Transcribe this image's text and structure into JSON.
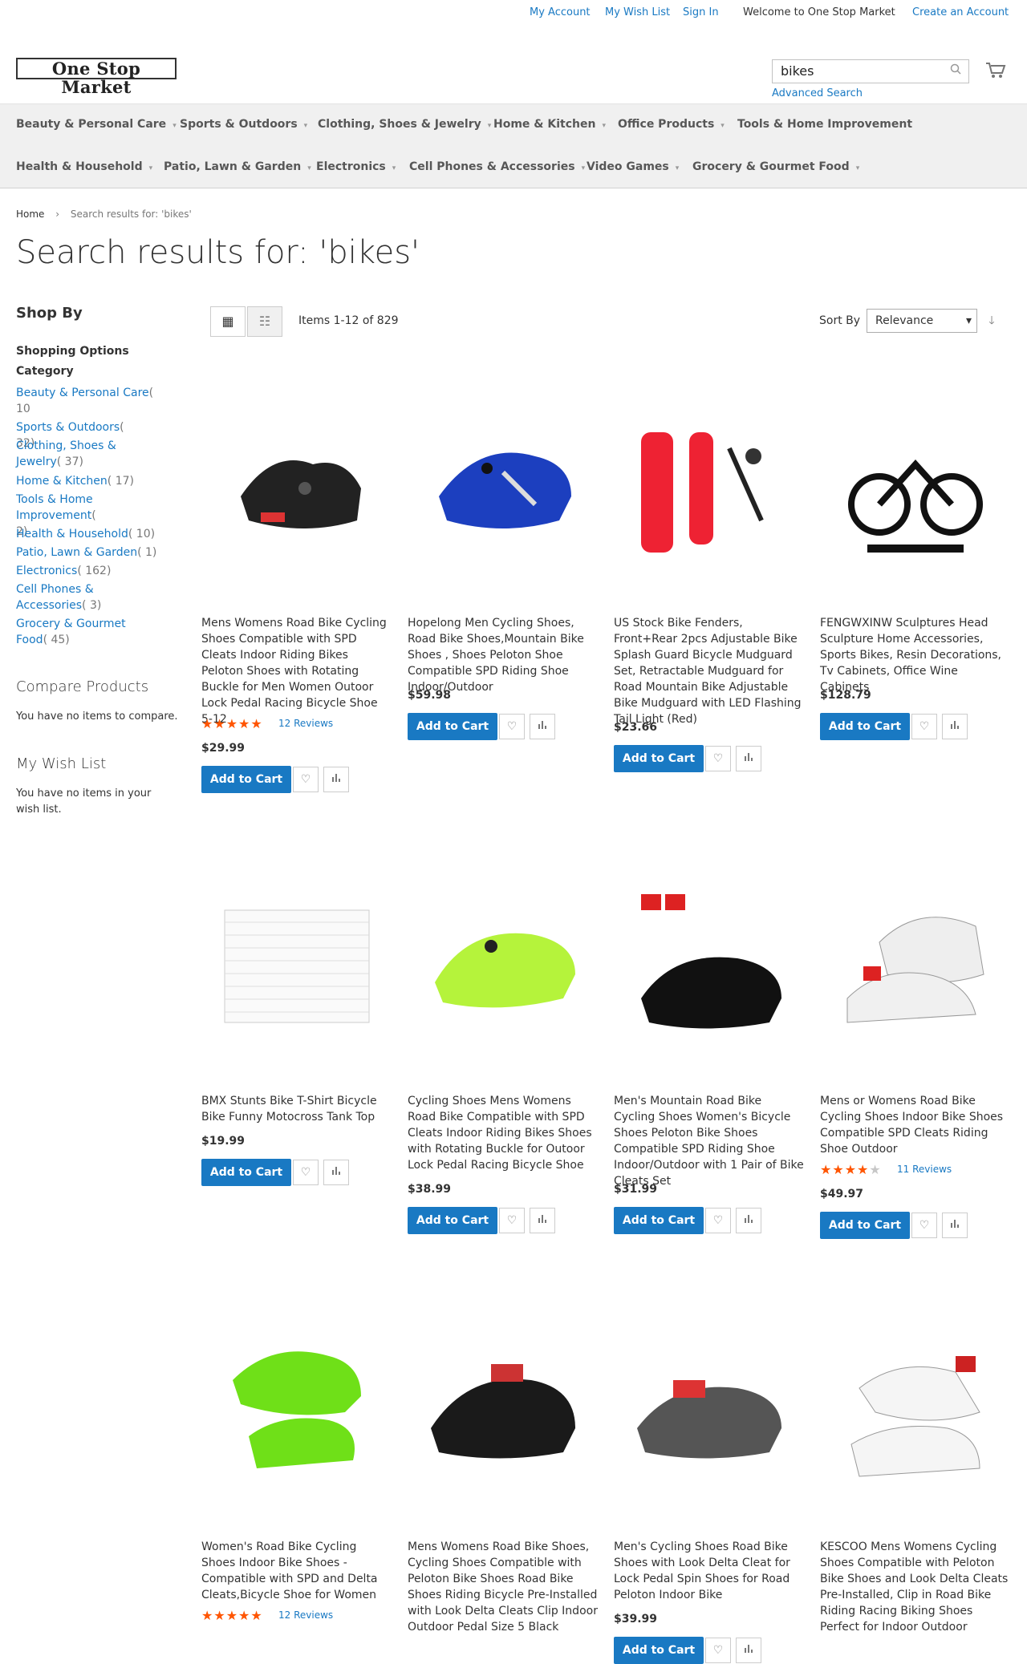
{
  "header": {
    "my_account": "My Account",
    "my_wish_list": "My Wish List",
    "sign_in": "Sign In",
    "welcome": "Welcome to One Stop Market",
    "create_account": "Create an Account",
    "logo": "One Stop Market",
    "search_value": "bikes",
    "advanced_search": "Advanced Search"
  },
  "nav": [
    "Beauty & Personal Care",
    "Sports & Outdoors",
    "Clothing, Shoes & Jewelry",
    "Home & Kitchen",
    "Office Products",
    "Tools & Home Improvement",
    "Health & Household",
    "Patio, Lawn & Garden",
    "Electronics",
    "Cell Phones & Accessories",
    "Video Games",
    "Grocery & Gourmet Food"
  ],
  "breadcrumb": {
    "home": "Home",
    "current": "Search results for: 'bikes'"
  },
  "page_title": "Search results for: 'bikes'",
  "sidebar": {
    "shop_by": "Shop By",
    "shopping_options": "Shopping Options",
    "category": "Category",
    "categories": [
      {
        "label": "Beauty & Personal Care",
        "count": "( 10"
      },
      {
        "label": "Sports & Outdoors",
        "count": "( 32)"
      },
      {
        "label": "Clothing, Shoes & Jewelry",
        "count": "( 37)"
      },
      {
        "label": "Home & Kitchen",
        "count": "( 17)"
      },
      {
        "label": "Tools & Home Improvement",
        "count": "( 2)"
      },
      {
        "label": "Health & Household",
        "count": "( 10)"
      },
      {
        "label": "Patio, Lawn & Garden",
        "count": "( 1)"
      },
      {
        "label": "Electronics",
        "count": "( 162)"
      },
      {
        "label": "Cell Phones & Accessories",
        "count": "( 3)"
      },
      {
        "label": "Grocery & Gourmet Food",
        "count": "( 45)"
      }
    ],
    "compare_title": "Compare Products",
    "compare_text": "You have no items to compare.",
    "wishlist_title": "My Wish List",
    "wishlist_text": "You have no items in your wish list."
  },
  "toolbar": {
    "amount": "Items 1-12 of 829",
    "sort_by": "Sort By",
    "sort_value": "Relevance"
  },
  "product_labels": {
    "add_to_cart": "Add to Cart"
  },
  "products": [
    {
      "name": "Mens Womens Road Bike Cycling Shoes Compatible with SPD Cleats Indoor Riding Bikes Peloton Shoes with Rotating Buckle for Men Women Outoor Lock Pedal Racing Bicycle Shoe 5-12",
      "price": "$29.99",
      "rating": 4.5,
      "reviews": "12  Reviews",
      "image": "black-cycling-shoe"
    },
    {
      "name": "Hopelong Men Cycling Shoes, Road Bike Shoes,Mountain Bike Shoes , Shoes Peloton Shoe Compatible SPD Riding Shoe Indoor/Outdoor",
      "price": "$59.98",
      "image": "blue-cycling-shoe"
    },
    {
      "name": "US Stock Bike Fenders, Front+Rear 2pcs Adjustable Bike Splash Guard Bicycle Mudguard Set, Retractable Mudguard for Road Mountain Bike Adjustable Bike Mudguard with LED Flashing Tail Light (Red)",
      "price": "$23.66",
      "image": "red-fenders"
    },
    {
      "name": "FENGWXINW Sculptures Head Sculpture Home Accessories, Sports Bikes, Resin Decorations, Tv Cabinets, Office Wine Cabinets",
      "price": "$128.79",
      "image": "bike-sculpture"
    },
    {
      "name": "BMX Stunts Bike T-Shirt Bicycle Bike Funny Motocross Tank Top",
      "price": "$19.99",
      "image": "size-chart"
    },
    {
      "name": "Cycling Shoes Mens Womens Road Bike Compatible with SPD Cleats Indoor Riding Bikes Shoes with Rotating Buckle for Outoor Lock Pedal Racing Bicycle Shoe",
      "price": "$38.99",
      "image": "lime-cycling-shoe"
    },
    {
      "name": "Men's Mountain Road Bike Cycling Shoes Women's Bicycle Shoes Peloton Bike Shoes Compatible SPD Riding Shoe Indoor/Outdoor with 1 Pair of Bike Cleats Set",
      "price": "$31.99",
      "image": "black-shoe-cleats"
    },
    {
      "name": "Mens or Womens Road Bike Cycling Shoes Indoor Bike Shoes Compatible SPD Cleats Riding Shoe Outdoor",
      "price": "$49.97",
      "rating": 4,
      "reviews": "11  Reviews",
      "image": "white-shoe-cleats"
    },
    {
      "name": "Women's Road Bike Cycling Shoes Indoor Bike Shoes - Compatible with SPD and Delta Cleats,Bicycle Shoe for Women",
      "price": "",
      "rating": 4.5,
      "reviews": "12  Reviews",
      "image": "green-shoes"
    },
    {
      "name": "Mens Womens Road Bike Shoes, Cycling Shoes Compatible with Peloton Bike Shoes Road Bike Shoes Riding Bicycle Pre-Installed with Look Delta Cleats Clip Indoor Outdoor Pedal Size 5 Black",
      "price": "",
      "image": "black-delta-shoe"
    },
    {
      "name": "Men's Cycling Shoes Road Bike Shoes with Look Delta Cleat for Lock Pedal Spin Shoes for Road Peloton Indoor Bike",
      "price": "$39.99",
      "image": "camo-shoe"
    },
    {
      "name": "KESCOO Mens Womens Cycling Shoes Compatible with Peloton Bike Shoes and Look Delta Cleats Pre-Installed, Clip in Road Bike Riding Racing Biking Shoes Perfect for Indoor Outdoor",
      "price": "",
      "image": "white-red-shoes"
    }
  ]
}
